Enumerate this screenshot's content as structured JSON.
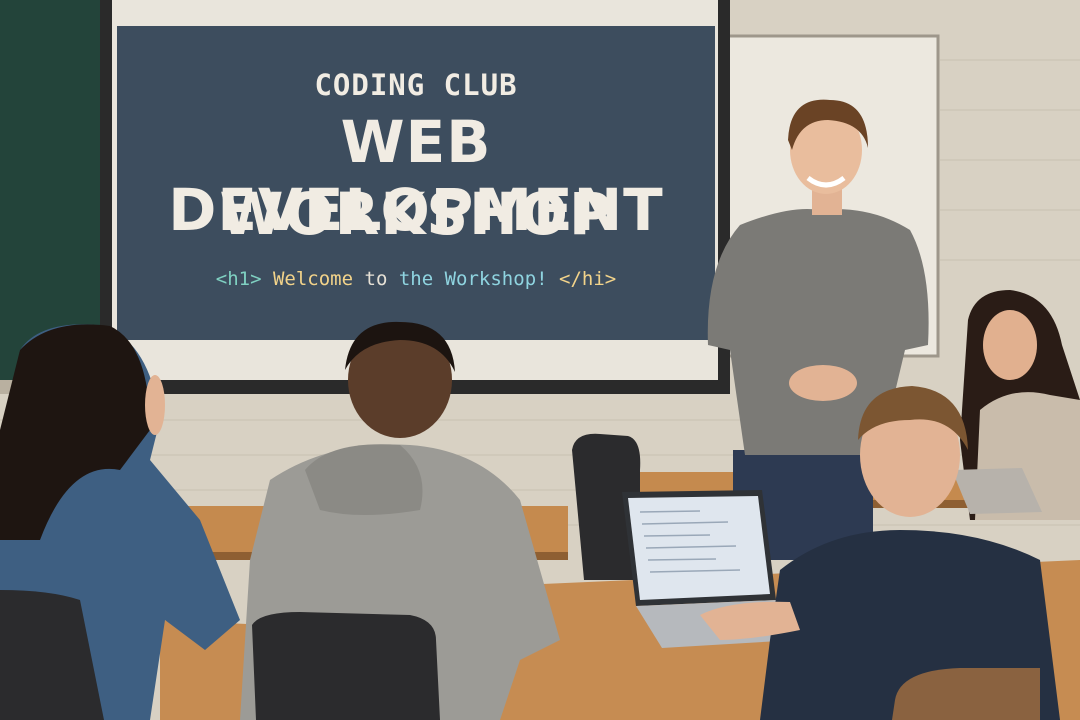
{
  "slide": {
    "club": "CODING CLUB",
    "title_line1": "WEB DEVELOPMENT",
    "title_line2": "WORKSHOP",
    "code_open_tag": "<h1>",
    "code_welcome": "Welcome",
    "code_to": "to",
    "code_the_workshop": "the Workshop!",
    "code_close_tag": "</hi>"
  },
  "colors": {
    "slide_background": "#3d4d5e",
    "wall": "#d9d2c4",
    "chalkboard": "#24453a",
    "desk": "#c58a4e"
  }
}
